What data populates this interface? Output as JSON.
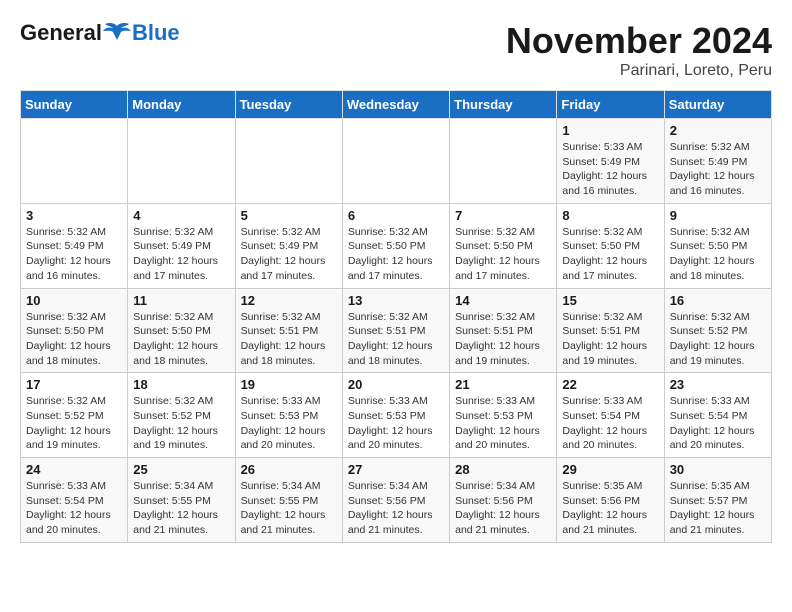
{
  "logo": {
    "text_general": "General",
    "text_blue": "Blue"
  },
  "header": {
    "title": "November 2024",
    "subtitle": "Parinari, Loreto, Peru"
  },
  "weekdays": [
    "Sunday",
    "Monday",
    "Tuesday",
    "Wednesday",
    "Thursday",
    "Friday",
    "Saturday"
  ],
  "weeks": [
    [
      {
        "day": "",
        "info": ""
      },
      {
        "day": "",
        "info": ""
      },
      {
        "day": "",
        "info": ""
      },
      {
        "day": "",
        "info": ""
      },
      {
        "day": "",
        "info": ""
      },
      {
        "day": "1",
        "info": "Sunrise: 5:33 AM\nSunset: 5:49 PM\nDaylight: 12 hours and 16 minutes."
      },
      {
        "day": "2",
        "info": "Sunrise: 5:32 AM\nSunset: 5:49 PM\nDaylight: 12 hours and 16 minutes."
      }
    ],
    [
      {
        "day": "3",
        "info": "Sunrise: 5:32 AM\nSunset: 5:49 PM\nDaylight: 12 hours and 16 minutes."
      },
      {
        "day": "4",
        "info": "Sunrise: 5:32 AM\nSunset: 5:49 PM\nDaylight: 12 hours and 17 minutes."
      },
      {
        "day": "5",
        "info": "Sunrise: 5:32 AM\nSunset: 5:49 PM\nDaylight: 12 hours and 17 minutes."
      },
      {
        "day": "6",
        "info": "Sunrise: 5:32 AM\nSunset: 5:50 PM\nDaylight: 12 hours and 17 minutes."
      },
      {
        "day": "7",
        "info": "Sunrise: 5:32 AM\nSunset: 5:50 PM\nDaylight: 12 hours and 17 minutes."
      },
      {
        "day": "8",
        "info": "Sunrise: 5:32 AM\nSunset: 5:50 PM\nDaylight: 12 hours and 17 minutes."
      },
      {
        "day": "9",
        "info": "Sunrise: 5:32 AM\nSunset: 5:50 PM\nDaylight: 12 hours and 18 minutes."
      }
    ],
    [
      {
        "day": "10",
        "info": "Sunrise: 5:32 AM\nSunset: 5:50 PM\nDaylight: 12 hours and 18 minutes."
      },
      {
        "day": "11",
        "info": "Sunrise: 5:32 AM\nSunset: 5:50 PM\nDaylight: 12 hours and 18 minutes."
      },
      {
        "day": "12",
        "info": "Sunrise: 5:32 AM\nSunset: 5:51 PM\nDaylight: 12 hours and 18 minutes."
      },
      {
        "day": "13",
        "info": "Sunrise: 5:32 AM\nSunset: 5:51 PM\nDaylight: 12 hours and 18 minutes."
      },
      {
        "day": "14",
        "info": "Sunrise: 5:32 AM\nSunset: 5:51 PM\nDaylight: 12 hours and 19 minutes."
      },
      {
        "day": "15",
        "info": "Sunrise: 5:32 AM\nSunset: 5:51 PM\nDaylight: 12 hours and 19 minutes."
      },
      {
        "day": "16",
        "info": "Sunrise: 5:32 AM\nSunset: 5:52 PM\nDaylight: 12 hours and 19 minutes."
      }
    ],
    [
      {
        "day": "17",
        "info": "Sunrise: 5:32 AM\nSunset: 5:52 PM\nDaylight: 12 hours and 19 minutes."
      },
      {
        "day": "18",
        "info": "Sunrise: 5:32 AM\nSunset: 5:52 PM\nDaylight: 12 hours and 19 minutes."
      },
      {
        "day": "19",
        "info": "Sunrise: 5:33 AM\nSunset: 5:53 PM\nDaylight: 12 hours and 20 minutes."
      },
      {
        "day": "20",
        "info": "Sunrise: 5:33 AM\nSunset: 5:53 PM\nDaylight: 12 hours and 20 minutes."
      },
      {
        "day": "21",
        "info": "Sunrise: 5:33 AM\nSunset: 5:53 PM\nDaylight: 12 hours and 20 minutes."
      },
      {
        "day": "22",
        "info": "Sunrise: 5:33 AM\nSunset: 5:54 PM\nDaylight: 12 hours and 20 minutes."
      },
      {
        "day": "23",
        "info": "Sunrise: 5:33 AM\nSunset: 5:54 PM\nDaylight: 12 hours and 20 minutes."
      }
    ],
    [
      {
        "day": "24",
        "info": "Sunrise: 5:33 AM\nSunset: 5:54 PM\nDaylight: 12 hours and 20 minutes."
      },
      {
        "day": "25",
        "info": "Sunrise: 5:34 AM\nSunset: 5:55 PM\nDaylight: 12 hours and 21 minutes."
      },
      {
        "day": "26",
        "info": "Sunrise: 5:34 AM\nSunset: 5:55 PM\nDaylight: 12 hours and 21 minutes."
      },
      {
        "day": "27",
        "info": "Sunrise: 5:34 AM\nSunset: 5:56 PM\nDaylight: 12 hours and 21 minutes."
      },
      {
        "day": "28",
        "info": "Sunrise: 5:34 AM\nSunset: 5:56 PM\nDaylight: 12 hours and 21 minutes."
      },
      {
        "day": "29",
        "info": "Sunrise: 5:35 AM\nSunset: 5:56 PM\nDaylight: 12 hours and 21 minutes."
      },
      {
        "day": "30",
        "info": "Sunrise: 5:35 AM\nSunset: 5:57 PM\nDaylight: 12 hours and 21 minutes."
      }
    ]
  ]
}
